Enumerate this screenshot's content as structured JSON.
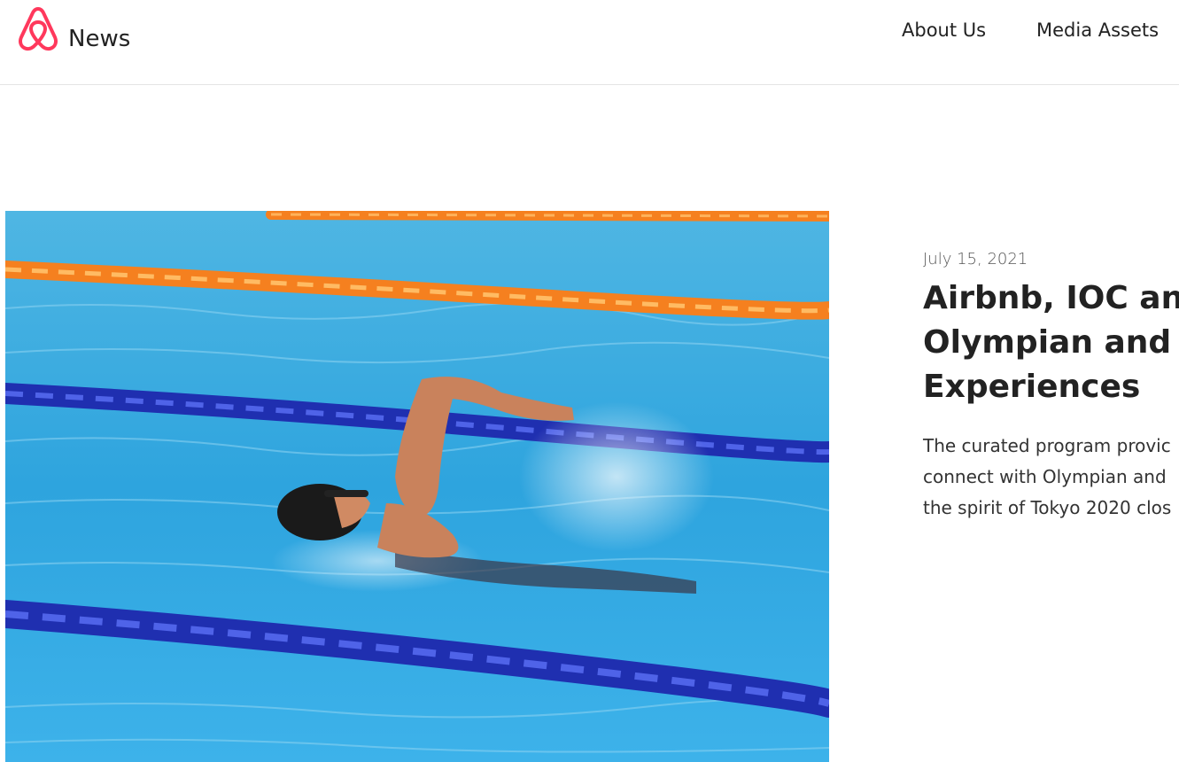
{
  "header": {
    "brand": "News",
    "nav": [
      {
        "label": "About Us"
      },
      {
        "label": "Media Assets"
      }
    ]
  },
  "colors": {
    "brand": "#FF385C",
    "water": "#3fb0e6",
    "lane_orange": "#f5801f",
    "lane_blue": "#1f2fb0"
  },
  "article": {
    "date": "July 15, 2021",
    "title_lines": [
      "Airbnb, IOC and",
      "Olympian and P",
      "Experiences"
    ],
    "summary_lines": [
      "The curated program provic",
      "connect with Olympian and",
      "the spirit of Tokyo 2020 clos"
    ]
  }
}
